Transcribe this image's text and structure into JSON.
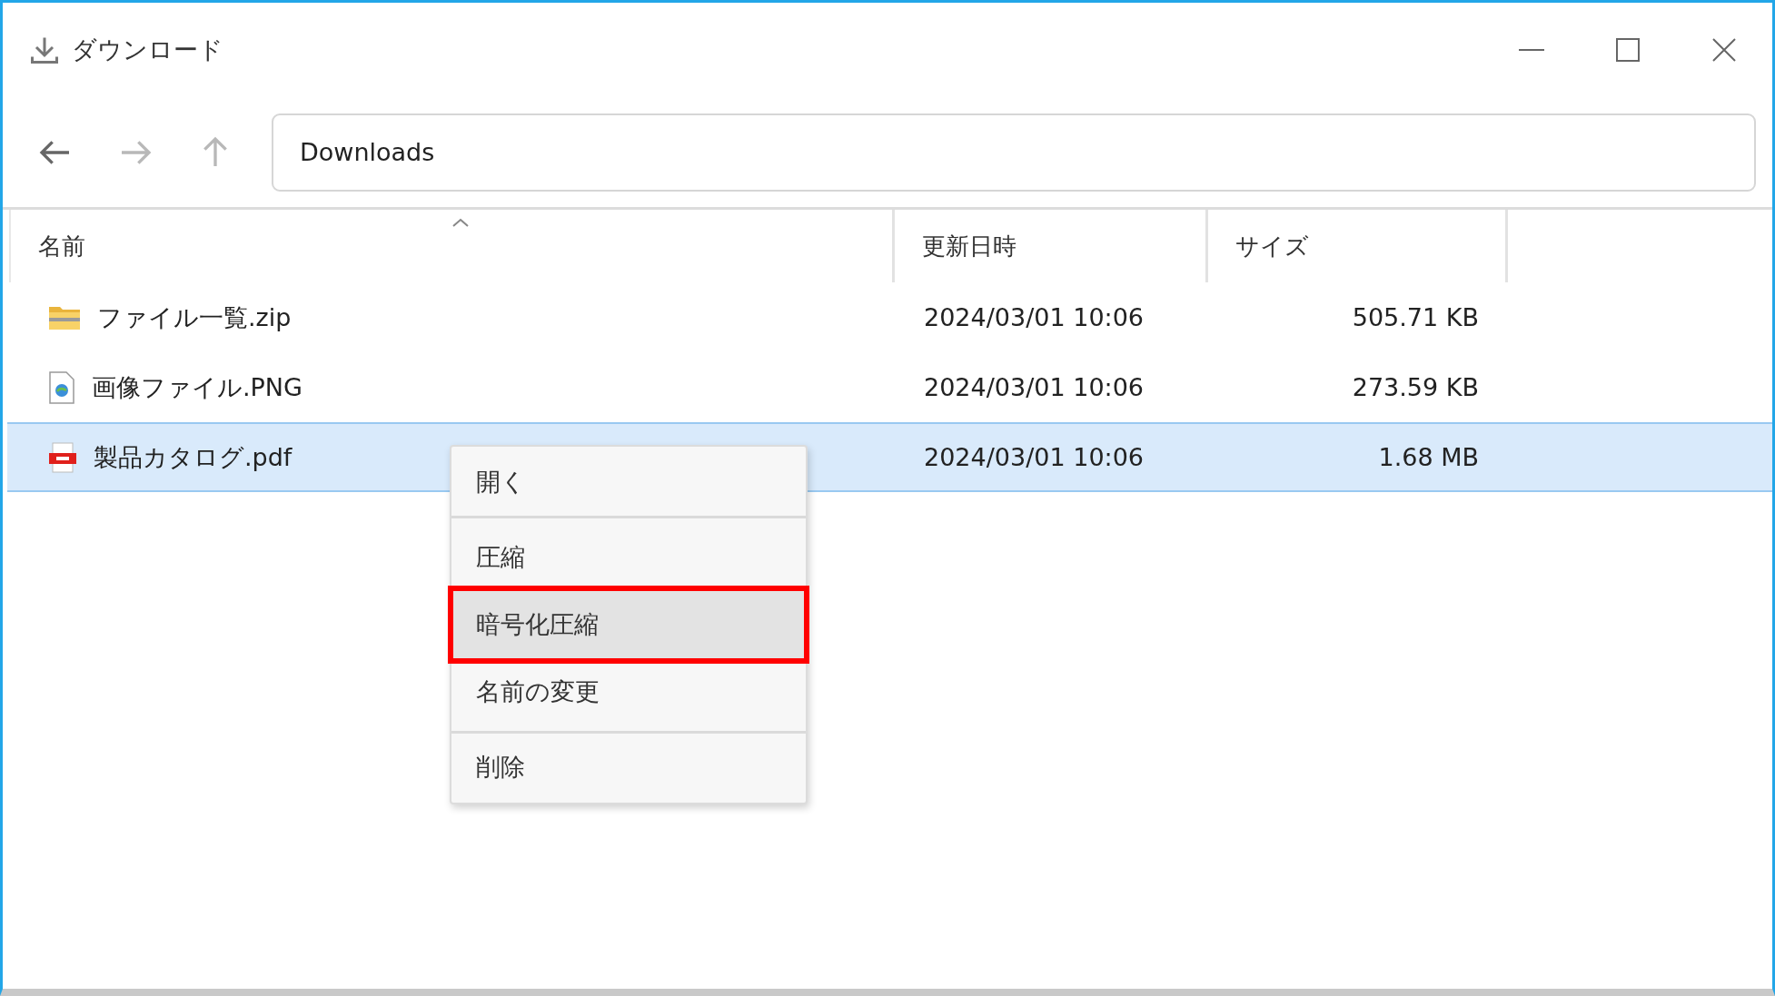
{
  "window": {
    "title": "ダウンロード"
  },
  "navigation": {
    "buttons": [
      {
        "kind": "back",
        "disabled": false
      },
      {
        "kind": "forward",
        "disabled": true
      },
      {
        "kind": "up",
        "disabled": true
      }
    ],
    "address": "Downloads"
  },
  "table": {
    "columns": [
      {
        "label": "名前",
        "sorted": true
      },
      {
        "label": "更新日時",
        "sorted": false
      },
      {
        "label": "サイズ",
        "sorted": false
      }
    ],
    "rows": [
      {
        "kind": "zip",
        "name": "ファイル一覧.zip",
        "modified": "2024/03/01 10:06",
        "size": "505.71 KB",
        "selected": false
      },
      {
        "kind": "image",
        "name": "画像ファイル.PNG",
        "modified": "2024/03/01 10:06",
        "size": "273.59 KB",
        "selected": false
      },
      {
        "kind": "pdf",
        "name": "製品カタログ.pdf",
        "modified": "2024/03/01 10:06",
        "size": "1.68 MB",
        "selected": true
      }
    ]
  },
  "context_menu": {
    "groups": [
      [
        {
          "label": "開く",
          "selected": false,
          "marked": false
        }
      ],
      [
        {
          "label": "圧縮",
          "selected": false,
          "marked": false
        },
        {
          "label": "暗号化圧縮",
          "selected": true,
          "marked": true
        },
        {
          "label": "名前の変更",
          "selected": false,
          "marked": false
        }
      ],
      [
        {
          "label": "削除",
          "selected": false,
          "marked": false
        }
      ]
    ]
  }
}
